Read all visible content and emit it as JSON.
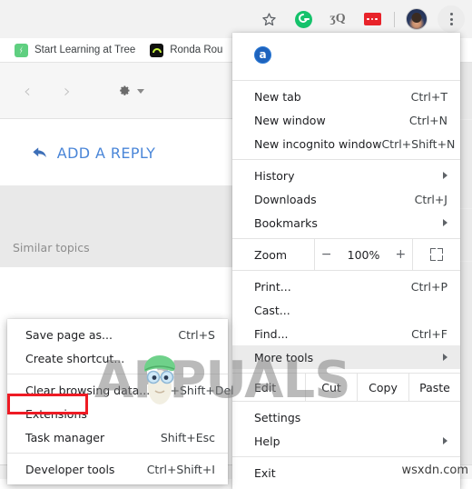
{
  "toolbar": {
    "icons": [
      {
        "name": "star-icon",
        "label": "Bookmark this page"
      },
      {
        "name": "grammarly-icon",
        "label": "Grammarly"
      },
      {
        "name": "extension-gray-icon",
        "label": "Extension"
      },
      {
        "name": "extension-red-icon",
        "label": "Extension"
      },
      {
        "name": "profile-avatar",
        "label": "Profile"
      },
      {
        "name": "chrome-menu-icon",
        "label": "Customize and control Google Chrome"
      }
    ]
  },
  "bookmarks_bar": {
    "items": [
      {
        "label": "Start Learning at Tree",
        "icon": "treehouse-favicon"
      },
      {
        "label": "Ronda Rou",
        "icon": "ronda-favicon"
      }
    ]
  },
  "page": {
    "reply_button": "ADD A REPLY",
    "similar_topics": "Similar topics",
    "nav_prev": "‹",
    "nav_next": "›",
    "gear_icon": "gear-icon"
  },
  "chrome_menu": {
    "extension_row": {
      "icon": "amazon-assistant-icon",
      "icon_letter": "a"
    },
    "groups": [
      {
        "items": [
          {
            "label": "New tab",
            "accel": "Ctrl+T",
            "arrow": false,
            "highlighted": false
          },
          {
            "label": "New window",
            "accel": "Ctrl+N",
            "arrow": false,
            "highlighted": false
          },
          {
            "label": "New incognito window",
            "accel": "Ctrl+Shift+N",
            "arrow": false,
            "highlighted": false
          }
        ]
      },
      {
        "items": [
          {
            "label": "History",
            "accel": "",
            "arrow": true,
            "highlighted": false
          },
          {
            "label": "Downloads",
            "accel": "Ctrl+J",
            "arrow": false,
            "highlighted": false
          },
          {
            "label": "Bookmarks",
            "accel": "",
            "arrow": true,
            "highlighted": false
          }
        ]
      }
    ],
    "zoom_row": {
      "label": "Zoom",
      "minus": "−",
      "value": "100%",
      "plus": "+",
      "fullscreen_icon": "fullscreen-icon"
    },
    "group3": {
      "items": [
        {
          "label": "Print...",
          "accel": "Ctrl+P",
          "arrow": false,
          "highlighted": false
        },
        {
          "label": "Cast...",
          "accel": "",
          "arrow": false,
          "highlighted": false
        },
        {
          "label": "Find...",
          "accel": "Ctrl+F",
          "arrow": false,
          "highlighted": false
        },
        {
          "label": "More tools",
          "accel": "",
          "arrow": true,
          "highlighted": true
        }
      ]
    },
    "edit_row": {
      "label": "Edit",
      "buttons": [
        "Cut",
        "Copy",
        "Paste"
      ]
    },
    "group4": {
      "items": [
        {
          "label": "Settings",
          "accel": "",
          "arrow": false,
          "highlighted": false
        },
        {
          "label": "Help",
          "accel": "",
          "arrow": true,
          "highlighted": false
        }
      ]
    },
    "group5": {
      "items": [
        {
          "label": "Exit",
          "accel": "",
          "arrow": false,
          "highlighted": false
        }
      ]
    }
  },
  "more_tools_submenu": {
    "groups": [
      {
        "items": [
          {
            "label": "Save page as...",
            "accel": "Ctrl+S",
            "highlighted": false
          },
          {
            "label": "Create shortcut...",
            "accel": "",
            "highlighted": false
          }
        ]
      },
      {
        "items": [
          {
            "label": "Clear browsing data...",
            "accel": "Ctrl+Shift+Del",
            "highlighted": false
          },
          {
            "label": "Extensions",
            "accel": "",
            "highlighted": true
          },
          {
            "label": "Task manager",
            "accel": "Shift+Esc",
            "highlighted": false
          }
        ]
      },
      {
        "items": [
          {
            "label": "Developer tools",
            "accel": "Ctrl+Shift+I",
            "highlighted": false
          }
        ]
      }
    ],
    "highlight_color": "#ee1b24"
  },
  "watermarks": {
    "appuals": "APPUALS",
    "wsxdn": "wsxdn.com"
  }
}
